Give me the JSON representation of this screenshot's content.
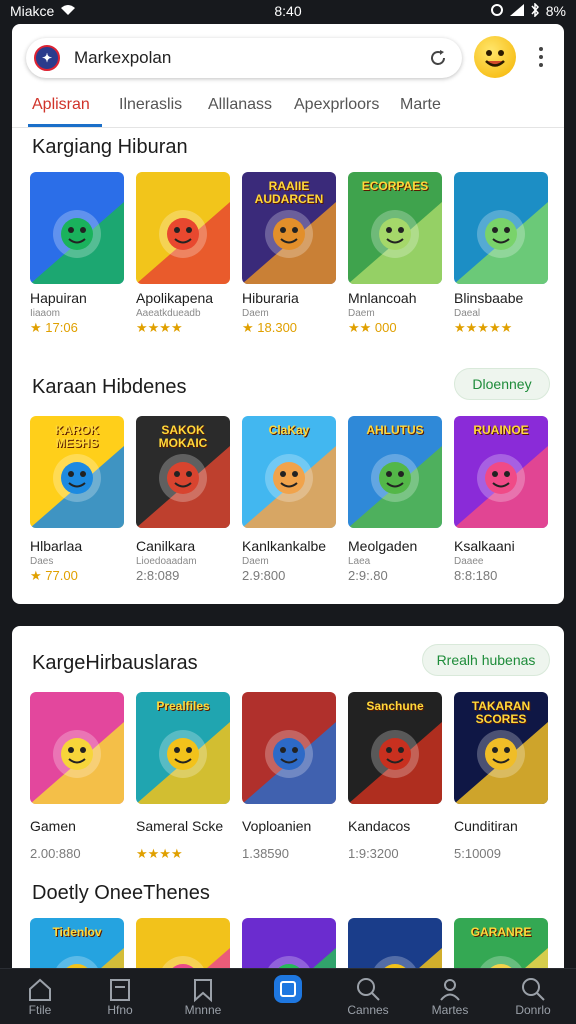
{
  "status": {
    "left": "Miakce",
    "time": "8:40",
    "battery": "8%"
  },
  "search": {
    "text": "Markexpolan"
  },
  "tabs": [
    {
      "label": "Aplisran",
      "active": true
    },
    {
      "label": "Ilneraslis",
      "active": false
    },
    {
      "label": "Alllanass",
      "active": false
    },
    {
      "label": "Apexprloors",
      "active": false
    },
    {
      "label": "Marte",
      "active": false
    }
  ],
  "sections": [
    {
      "title": "Kargiang Hiburan",
      "apps": [
        {
          "name": "Hapuiran",
          "sub": "Iiaaom",
          "rating": "★ 17:06",
          "colors": [
            "#2b6ee8",
            "#1ab25c"
          ]
        },
        {
          "name": "Apolikapena",
          "sub": "Aaeatkdueadb",
          "rating": "★★★★",
          "colors": [
            "#f2c51b",
            "#e8482f"
          ]
        },
        {
          "name": "Hiburaria",
          "sub": "Daem",
          "rating": "★ 18.300",
          "colors": [
            "#3a2a7a",
            "#e38f2a"
          ]
        },
        {
          "name": "Mnlancoah",
          "sub": "Daem",
          "rating": "★★ 000",
          "colors": [
            "#3fa34d",
            "#a5d86a"
          ]
        },
        {
          "name": "Blinsbaabe",
          "sub": "Daeal",
          "rating": "★★★★★",
          "colors": [
            "#1c8ec5",
            "#79d36a"
          ]
        }
      ]
    },
    {
      "title": "Karaan Hibdenes",
      "action": "Dloenney",
      "apps": [
        {
          "name": "Hlbarlaa",
          "sub": "Daes",
          "rating": "★ 77.00",
          "colors": [
            "#ffcf1a",
            "#1d8ae0"
          ]
        },
        {
          "name": "Canilkara",
          "sub": "Lioedoaadam",
          "rating": "2:8:089",
          "colors": [
            "#2b2b2b",
            "#d8442f"
          ]
        },
        {
          "name": "Kanlkankalbe",
          "sub": "Daem",
          "rating": "2.9:800",
          "colors": [
            "#42b7f0",
            "#f1a34b"
          ]
        },
        {
          "name": "Meolgaden",
          "sub": "Laea",
          "rating": "2:9:.80",
          "colors": [
            "#2f89d8",
            "#53b748"
          ]
        },
        {
          "name": "Ksalkaani",
          "sub": "Daaee",
          "rating": "8:8:180",
          "colors": [
            "#8a2bd8",
            "#f04a87"
          ]
        }
      ]
    },
    {
      "title": "KargeHirbauslaras",
      "action": "Rrealh hubenas",
      "apps": [
        {
          "name": "Gamen",
          "sub": "",
          "rating": "2.00:880",
          "colors": [
            "#e3479d",
            "#f7d53a"
          ]
        },
        {
          "name": "Sameral Scke",
          "sub": "",
          "rating": "★★★★",
          "colors": [
            "#20a5b0",
            "#f2c21b"
          ]
        },
        {
          "name": "Voploanien",
          "sub": "",
          "rating": "1.38590",
          "colors": [
            "#b0302c",
            "#2d6ac7"
          ]
        },
        {
          "name": "Kandacos",
          "sub": "",
          "rating": "1:9:3200",
          "colors": [
            "#222",
            "#c8301f"
          ]
        },
        {
          "name": "Cunditiran",
          "sub": "",
          "rating": "5:10009",
          "colors": [
            "#0f1745",
            "#f0bd27"
          ]
        }
      ]
    },
    {
      "title": "Doetly OneeThenes",
      "apps": [
        {
          "colors": [
            "#25a3e0",
            "#f2c21b"
          ]
        },
        {
          "colors": [
            "#f2c21b",
            "#e94a8a"
          ]
        },
        {
          "colors": [
            "#6b2ccf",
            "#27b85a"
          ]
        },
        {
          "colors": [
            "#1a3d8a",
            "#f2c21b"
          ]
        },
        {
          "colors": [
            "#34a853",
            "#f2d34b"
          ]
        }
      ]
    }
  ],
  "tile_labels": {
    "s0_2": "RAAIIE AUDARCEN",
    "s0_3": "ECORPAES",
    "s1_0": "KAROK MESHS",
    "s1_1": "SAKOK MOKAIC",
    "s1_2": "ClaKay",
    "s1_3": "AHLUTUS",
    "s1_4": "RUAINOE",
    "s2_1": "Prealfiles",
    "s2_3": "Sanchune",
    "s2_4": "TAKARAN SCORES",
    "s3_0": "Tidenlov",
    "s3_4": "GARANRE"
  },
  "nav": [
    {
      "label": "Ftile",
      "icon": "home-icon",
      "active": false
    },
    {
      "label": "Hfno",
      "icon": "document-icon",
      "active": false
    },
    {
      "label": "Mnnne",
      "icon": "bookmark-icon",
      "active": false
    },
    {
      "label": "",
      "icon": "square-icon",
      "active": true
    },
    {
      "label": "Cannes",
      "icon": "search-icon",
      "active": false
    },
    {
      "label": "Martes",
      "icon": "profile-icon",
      "active": false
    },
    {
      "label": "Donrlo",
      "icon": "search-icon",
      "active": false
    }
  ]
}
